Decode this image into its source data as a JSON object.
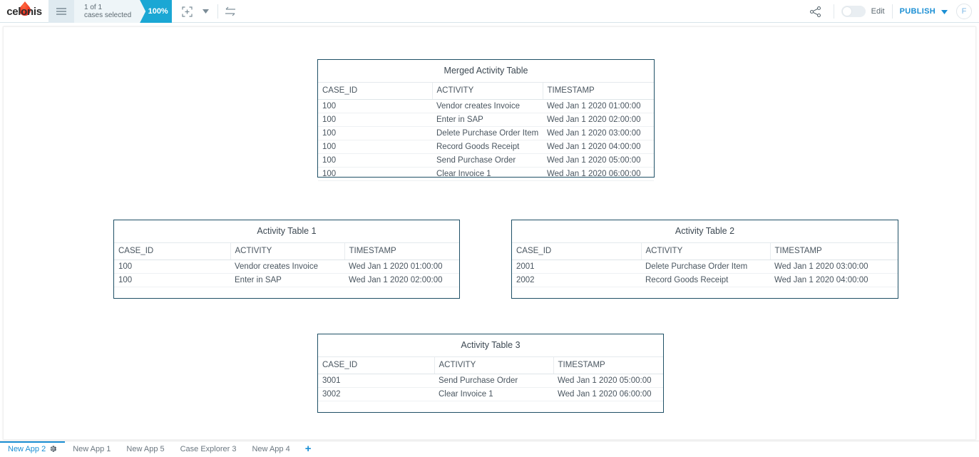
{
  "header": {
    "logo_text": "celonis",
    "logo_icon": "celonis-droplet-icon",
    "menu_icon": "hamburger-menu-icon",
    "selection": {
      "line1": "1 of 1",
      "line2": "cases selected",
      "percent": "100%"
    },
    "tools": {
      "selection_icon": "add-selection-icon",
      "dropdown_icon": "chevron-down-icon",
      "swap_icon": "swap-arrows-icon"
    },
    "share_icon": "share-icon",
    "edit_toggle": {
      "label": "Edit",
      "state": "off"
    },
    "publish": {
      "label": "PUBLISH",
      "caret_icon": "chevron-down-icon"
    },
    "avatar": {
      "initial": "F"
    },
    "accent_color": "#1ba7d4",
    "link_color": "#1b8fd4"
  },
  "widgets": [
    {
      "title": "Merged Activity Table",
      "columns": [
        "CASE_ID",
        "ACTIVITY",
        "TIMESTAMP"
      ],
      "rows": [
        [
          "100",
          "Vendor creates Invoice",
          "Wed Jan 1 2020 01:00:00"
        ],
        [
          "100",
          "Enter in SAP",
          "Wed Jan 1 2020 02:00:00"
        ],
        [
          "100",
          "Delete Purchase Order Item",
          "Wed Jan 1 2020 03:00:00"
        ],
        [
          "100",
          "Record Goods Receipt",
          "Wed Jan 1 2020 04:00:00"
        ],
        [
          "100",
          "Send Purchase Order",
          "Wed Jan 1 2020 05:00:00"
        ],
        [
          "100",
          "Clear Invoice 1",
          "Wed Jan 1 2020 06:00:00"
        ]
      ]
    },
    {
      "title": "Activity Table 1",
      "columns": [
        "CASE_ID",
        "ACTIVITY",
        "TIMESTAMP"
      ],
      "rows": [
        [
          "100",
          "Vendor creates Invoice",
          "Wed Jan 1 2020 01:00:00"
        ],
        [
          "100",
          "Enter in SAP",
          "Wed Jan 1 2020 02:00:00"
        ]
      ]
    },
    {
      "title": "Activity Table 2",
      "columns": [
        "CASE_ID",
        "ACTIVITY",
        "TIMESTAMP"
      ],
      "rows": [
        [
          "2001",
          "Delete Purchase Order Item",
          "Wed Jan 1 2020 03:00:00"
        ],
        [
          "2002",
          "Record Goods Receipt",
          "Wed Jan 1 2020 04:00:00"
        ]
      ]
    },
    {
      "title": "Activity Table 3",
      "columns": [
        "CASE_ID",
        "ACTIVITY",
        "TIMESTAMP"
      ],
      "rows": [
        [
          "3001",
          "Send Purchase Order",
          "Wed Jan 1 2020 05:00:00"
        ],
        [
          "3002",
          "Clear Invoice 1",
          "Wed Jan 1 2020 06:00:00"
        ]
      ]
    }
  ],
  "tabbar": {
    "tabs": [
      {
        "label": "New App 2",
        "active": true,
        "gear_icon": "gear-icon"
      },
      {
        "label": "New App 1",
        "active": false
      },
      {
        "label": "New App 5",
        "active": false
      },
      {
        "label": "Case Explorer 3",
        "active": false
      },
      {
        "label": "New App 4",
        "active": false
      }
    ],
    "add_label": "+"
  }
}
